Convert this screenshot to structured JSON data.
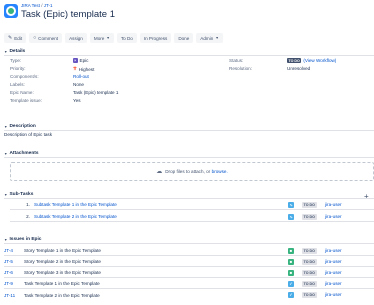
{
  "header": {
    "breadcrumb_project": "JIRA Test",
    "breadcrumb_sep": "/",
    "breadcrumb_issue": "JT-1",
    "title": "Task (Epic) template 1"
  },
  "toolbar": {
    "edit": "Edit",
    "comment": "Comment",
    "assign": "Assign",
    "more": "More",
    "todo": "To Do",
    "in_progress": "In Progress",
    "done": "Done",
    "admin": "Admin"
  },
  "details": {
    "heading": "Details",
    "type_label": "Type:",
    "type_value": "Epic",
    "priority_label": "Priority:",
    "priority_value": "Highest",
    "components_label": "Component/s:",
    "components_value": "Roll-out",
    "labels_label": "Labels:",
    "labels_value": "None",
    "epic_name_label": "Epic Name:",
    "epic_name_value": "Task (Epic) template 1",
    "template_issue_label": "Template issue:",
    "template_issue_value": "Yes",
    "status_label": "Status:",
    "status_value": "TO DO",
    "view_workflow": "(View Workflow)",
    "resolution_label": "Resolution:",
    "resolution_value": "Unresolved"
  },
  "description": {
    "heading": "Description",
    "text": "Description of Epic task"
  },
  "attachments": {
    "heading": "Attachments",
    "drop_text": "Drop files to attach, or",
    "browse": "browse."
  },
  "subtasks": {
    "heading": "Sub-Tasks",
    "rows": [
      {
        "num": "1.",
        "summary": "Subtask Template 1 in the Epic Template",
        "status": "TO DO",
        "assignee": "jira-user"
      },
      {
        "num": "2.",
        "summary": "Subtask Template 2 in the Epic Template",
        "status": "TO DO",
        "assignee": "jira-user"
      }
    ]
  },
  "issues_in_epic": {
    "heading": "Issues in Epic",
    "rows": [
      {
        "key": "JT-4",
        "summary": "Story Template 1 in the Epic Template",
        "type": "story",
        "status": "TO DO",
        "assignee": "jira-user"
      },
      {
        "key": "JT-5",
        "summary": "Story Template 2 in the Epic Template",
        "type": "story",
        "status": "TO DO",
        "assignee": "jira-user"
      },
      {
        "key": "JT-6",
        "summary": "Story Template 3 in the Epic Template",
        "type": "story",
        "status": "TO DO",
        "assignee": "jira-user"
      },
      {
        "key": "JT-9",
        "summary": "Task Template 1 in the Epic Template",
        "type": "task",
        "status": "TO DO",
        "assignee": "jira-user"
      },
      {
        "key": "JT-11",
        "summary": "Task Template 2 in the Epic Template",
        "type": "task",
        "status": "TO DO",
        "assignee": "jira-user"
      }
    ]
  }
}
